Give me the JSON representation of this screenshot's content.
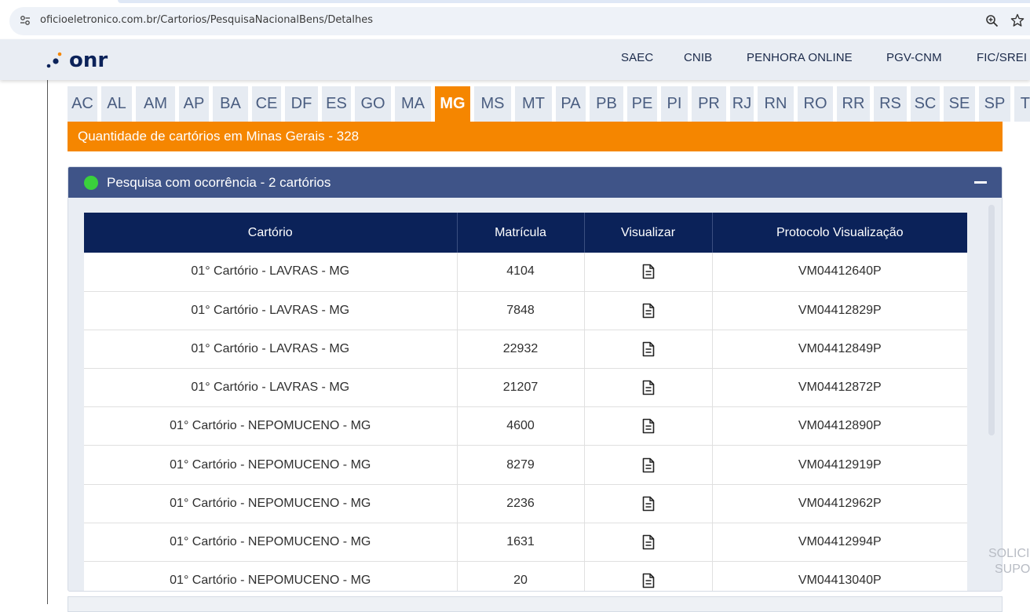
{
  "browser": {
    "url": "oficioeletronico.com.br/Cartorios/PesquisaNacionalBens/Detalhes",
    "icons": [
      "site-settings-icon",
      "zoom-icon",
      "bookmark-star-icon"
    ]
  },
  "header": {
    "logo_text": ".onr",
    "nav": [
      "SAEC",
      "CNIB",
      "PENHORA ONLINE",
      "PGV-CNM",
      "FIC/SREI"
    ]
  },
  "states": [
    "AC",
    "AL",
    "AM",
    "AP",
    "BA",
    "CE",
    "DF",
    "ES",
    "GO",
    "MA",
    "MG",
    "MS",
    "MT",
    "PA",
    "PB",
    "PE",
    "PI",
    "PR",
    "RJ",
    "RN",
    "RO",
    "RR",
    "RS",
    "SC",
    "SE",
    "SP",
    "TO"
  ],
  "active_state": "MG",
  "count_label": "Quantidade de cartórios em Minas Gerais - 328",
  "panel": {
    "title": "Pesquisa com ocorrência - 2 cartórios",
    "status_color": "#3ad13c"
  },
  "table": {
    "columns": [
      "Cartório",
      "Matrícula",
      "Visualizar",
      "Protocolo Visualização"
    ],
    "rows": [
      {
        "cartorio": "01° Cartório - LAVRAS - MG",
        "matricula": "4104",
        "protocolo": "VM04412640P"
      },
      {
        "cartorio": "01° Cartório - LAVRAS - MG",
        "matricula": "7848",
        "protocolo": "VM04412829P"
      },
      {
        "cartorio": "01° Cartório - LAVRAS - MG",
        "matricula": "22932",
        "protocolo": "VM04412849P"
      },
      {
        "cartorio": "01° Cartório - LAVRAS - MG",
        "matricula": "21207",
        "protocolo": "VM04412872P"
      },
      {
        "cartorio": "01° Cartório - NEPOMUCENO - MG",
        "matricula": "4600",
        "protocolo": "VM04412890P"
      },
      {
        "cartorio": "01° Cartório - NEPOMUCENO - MG",
        "matricula": "8279",
        "protocolo": "VM04412919P"
      },
      {
        "cartorio": "01° Cartório - NEPOMUCENO - MG",
        "matricula": "2236",
        "protocolo": "VM04412962P"
      },
      {
        "cartorio": "01° Cartório - NEPOMUCENO - MG",
        "matricula": "1631",
        "protocolo": "VM04412994P"
      },
      {
        "cartorio": "01° Cartório - NEPOMUCENO - MG",
        "matricula": "20",
        "protocolo": "VM04413040P"
      }
    ]
  },
  "side_text": [
    "SOLICI",
    "SUPO"
  ],
  "colors": {
    "accent_orange": "#f58600",
    "panel_header": "#3f5488",
    "table_header": "#0b2259"
  }
}
